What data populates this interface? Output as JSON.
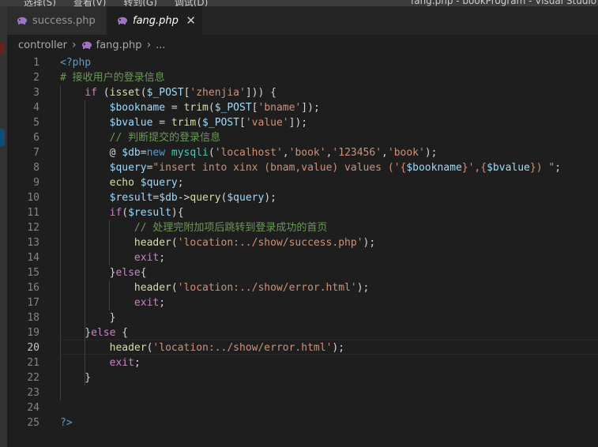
{
  "window": {
    "menu": [
      "选择(S)",
      "查看(V)",
      "转到(G)",
      "调试(D)"
    ],
    "title": "fang.php - bookProgram - Visual Studio Code"
  },
  "tabs": [
    {
      "label": "success.php",
      "active": false
    },
    {
      "label": "fang.php",
      "active": true,
      "close": "✕"
    }
  ],
  "breadcrumb": {
    "folder": "controller",
    "file": "fang.php",
    "symbol": "..."
  },
  "editor": {
    "active_line": 20,
    "colors": {
      "background": "#1e1e1e",
      "keyword": "#c586c0",
      "string": "#ce9178",
      "variable": "#9cdcfe",
      "comment": "#6a9955",
      "function": "#dcdcaa",
      "tag": "#569cd6"
    },
    "lines": [
      {
        "n": "1",
        "tokens": [
          [
            "tag",
            "<?php"
          ]
        ]
      },
      {
        "n": "2",
        "tokens": [
          [
            "cmt",
            "# 接收用户的登录信息"
          ]
        ]
      },
      {
        "n": "3",
        "tokens": [
          [
            "op",
            "    "
          ],
          [
            "kw",
            "if"
          ],
          [
            "op",
            " ("
          ],
          [
            "fn",
            "isset"
          ],
          [
            "op",
            "("
          ],
          [
            "var",
            "$_POST"
          ],
          [
            "op",
            "["
          ],
          [
            "str",
            "'zhenjia'"
          ],
          [
            "op",
            "])) {"
          ]
        ]
      },
      {
        "n": "4",
        "tokens": [
          [
            "op",
            "        "
          ],
          [
            "var",
            "$bookname"
          ],
          [
            "op",
            " = "
          ],
          [
            "fn",
            "trim"
          ],
          [
            "op",
            "("
          ],
          [
            "var",
            "$_POST"
          ],
          [
            "op",
            "["
          ],
          [
            "str",
            "'bname'"
          ],
          [
            "op",
            "]);"
          ]
        ]
      },
      {
        "n": "5",
        "tokens": [
          [
            "op",
            "        "
          ],
          [
            "var",
            "$bvalue"
          ],
          [
            "op",
            " = "
          ],
          [
            "fn",
            "trim"
          ],
          [
            "op",
            "("
          ],
          [
            "var",
            "$_POST"
          ],
          [
            "op",
            "["
          ],
          [
            "str",
            "'value'"
          ],
          [
            "op",
            "]);"
          ]
        ]
      },
      {
        "n": "6",
        "tokens": [
          [
            "op",
            "        "
          ],
          [
            "cmt",
            "// 判断提交的登录信息"
          ]
        ]
      },
      {
        "n": "7",
        "tokens": [
          [
            "op",
            "        @ "
          ],
          [
            "var",
            "$db"
          ],
          [
            "op",
            "="
          ],
          [
            "ctl",
            "new"
          ],
          [
            "op",
            " "
          ],
          [
            "cls",
            "mysqli"
          ],
          [
            "op",
            "("
          ],
          [
            "str",
            "'localhost'"
          ],
          [
            "op",
            ","
          ],
          [
            "str",
            "'book'"
          ],
          [
            "op",
            ","
          ],
          [
            "str",
            "'123456'"
          ],
          [
            "op",
            ","
          ],
          [
            "str",
            "'book'"
          ],
          [
            "op",
            ");"
          ]
        ]
      },
      {
        "n": "8",
        "tokens": [
          [
            "op",
            "        "
          ],
          [
            "var",
            "$query"
          ],
          [
            "op",
            "="
          ],
          [
            "str",
            "\"insert into xinx (bnam,value) values ('{"
          ],
          [
            "var",
            "$bookname"
          ],
          [
            "str",
            "}',{"
          ],
          [
            "var",
            "$bvalue"
          ],
          [
            "str",
            "}) \""
          ],
          [
            "op",
            ";"
          ]
        ]
      },
      {
        "n": "9",
        "tokens": [
          [
            "op",
            "        "
          ],
          [
            "fn",
            "echo"
          ],
          [
            "op",
            " "
          ],
          [
            "var",
            "$query"
          ],
          [
            "op",
            ";"
          ]
        ]
      },
      {
        "n": "10",
        "tokens": [
          [
            "op",
            "        "
          ],
          [
            "var",
            "$result"
          ],
          [
            "op",
            "="
          ],
          [
            "var",
            "$db"
          ],
          [
            "op",
            "->"
          ],
          [
            "fn",
            "query"
          ],
          [
            "op",
            "("
          ],
          [
            "var",
            "$query"
          ],
          [
            "op",
            ");"
          ]
        ]
      },
      {
        "n": "11",
        "tokens": [
          [
            "op",
            "        "
          ],
          [
            "kw",
            "if"
          ],
          [
            "op",
            "("
          ],
          [
            "var",
            "$result"
          ],
          [
            "op",
            "){"
          ]
        ]
      },
      {
        "n": "12",
        "tokens": [
          [
            "op",
            "            "
          ],
          [
            "cmt",
            "// 处理完附加项后跳转到登录成功的首页"
          ]
        ]
      },
      {
        "n": "13",
        "tokens": [
          [
            "op",
            "            "
          ],
          [
            "fn",
            "header"
          ],
          [
            "op",
            "("
          ],
          [
            "str",
            "'location:../show/success.php'"
          ],
          [
            "op",
            ");"
          ]
        ]
      },
      {
        "n": "14",
        "tokens": [
          [
            "op",
            "            "
          ],
          [
            "kw",
            "exit"
          ],
          [
            "op",
            ";"
          ]
        ]
      },
      {
        "n": "15",
        "tokens": [
          [
            "op",
            "        }"
          ],
          [
            "kw",
            "else"
          ],
          [
            "op",
            "{"
          ]
        ]
      },
      {
        "n": "16",
        "tokens": [
          [
            "op",
            "            "
          ],
          [
            "fn",
            "header"
          ],
          [
            "op",
            "("
          ],
          [
            "str",
            "'location:../show/error.html'"
          ],
          [
            "op",
            ");"
          ]
        ]
      },
      {
        "n": "17",
        "tokens": [
          [
            "op",
            "            "
          ],
          [
            "kw",
            "exit"
          ],
          [
            "op",
            ";"
          ]
        ]
      },
      {
        "n": "18",
        "tokens": [
          [
            "op",
            "        }"
          ]
        ]
      },
      {
        "n": "19",
        "tokens": [
          [
            "op",
            "    }"
          ],
          [
            "kw",
            "else"
          ],
          [
            "op",
            " {"
          ]
        ]
      },
      {
        "n": "20",
        "tokens": [
          [
            "op",
            "        "
          ],
          [
            "fn",
            "header"
          ],
          [
            "op",
            "("
          ],
          [
            "str",
            "'location:../show/error.html'"
          ],
          [
            "op",
            ");"
          ]
        ]
      },
      {
        "n": "21",
        "tokens": [
          [
            "op",
            "        "
          ],
          [
            "kw",
            "exit"
          ],
          [
            "op",
            ";"
          ]
        ]
      },
      {
        "n": "22",
        "tokens": [
          [
            "op",
            "    }"
          ]
        ]
      },
      {
        "n": "23",
        "tokens": []
      },
      {
        "n": "24",
        "tokens": []
      },
      {
        "n": "25",
        "tokens": [
          [
            "tag",
            "?>"
          ]
        ]
      }
    ]
  }
}
